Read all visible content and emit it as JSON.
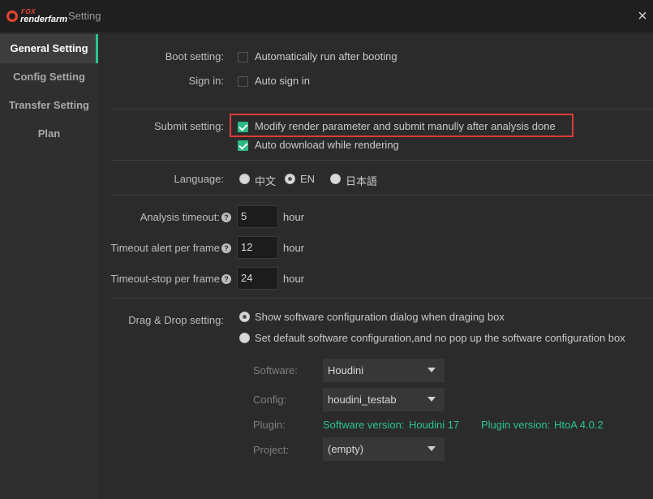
{
  "window": {
    "logo_fox": "FOX",
    "logo_renderfarm": "renderfarm",
    "title": "Setting",
    "close_icon": "×"
  },
  "sidebar": {
    "items": [
      {
        "label": "General Setting",
        "active": true
      },
      {
        "label": "Config Setting",
        "active": false
      },
      {
        "label": "Transfer Setting",
        "active": false
      },
      {
        "label": "Plan",
        "active": false
      }
    ]
  },
  "boot": {
    "label": "Boot setting:",
    "auto_run": {
      "text": "Automatically run after booting",
      "checked": false
    }
  },
  "signin": {
    "label": "Sign in:",
    "auto_sign": {
      "text": "Auto sign in",
      "checked": false
    }
  },
  "submit": {
    "label": "Submit setting:",
    "modify": {
      "text": "Modify render parameter and submit manully after analysis done",
      "checked": true
    },
    "auto_download": {
      "text": "Auto download while rendering",
      "checked": true
    }
  },
  "language": {
    "label": "Language:",
    "options": [
      "中文",
      "EN",
      "日本語"
    ],
    "selected": "EN"
  },
  "timeouts": {
    "analysis": {
      "label": "Analysis timeout:",
      "value": "5",
      "unit": "hour"
    },
    "alert": {
      "label": "Timeout alert per frame",
      "value": "12",
      "unit": "hour"
    },
    "stop": {
      "label": "Timeout-stop per frame",
      "value": "24",
      "unit": "hour"
    },
    "help_icon": "?"
  },
  "dragdrop": {
    "label": "Drag & Drop setting:",
    "option_show": "Show software configuration dialog when draging box",
    "option_default": "Set default software configuration,and no pop up the software configuration box",
    "selected": "show"
  },
  "software_config": {
    "software_label": "Software:",
    "software_value": "Houdini",
    "config_label": "Config:",
    "config_value": "houdini_testab",
    "plugin_label": "Plugin:",
    "software_version_label": "Software version:",
    "software_version_value": "Houdini 17",
    "plugin_version_label": "Plugin version:",
    "plugin_version_value": "HtoA 4.0.2",
    "project_label": "Project:",
    "project_value": "(empty)"
  },
  "colors": {
    "accent": "#2cc58f",
    "highlight_border": "#e03a3a",
    "brand": "#e8452f"
  }
}
